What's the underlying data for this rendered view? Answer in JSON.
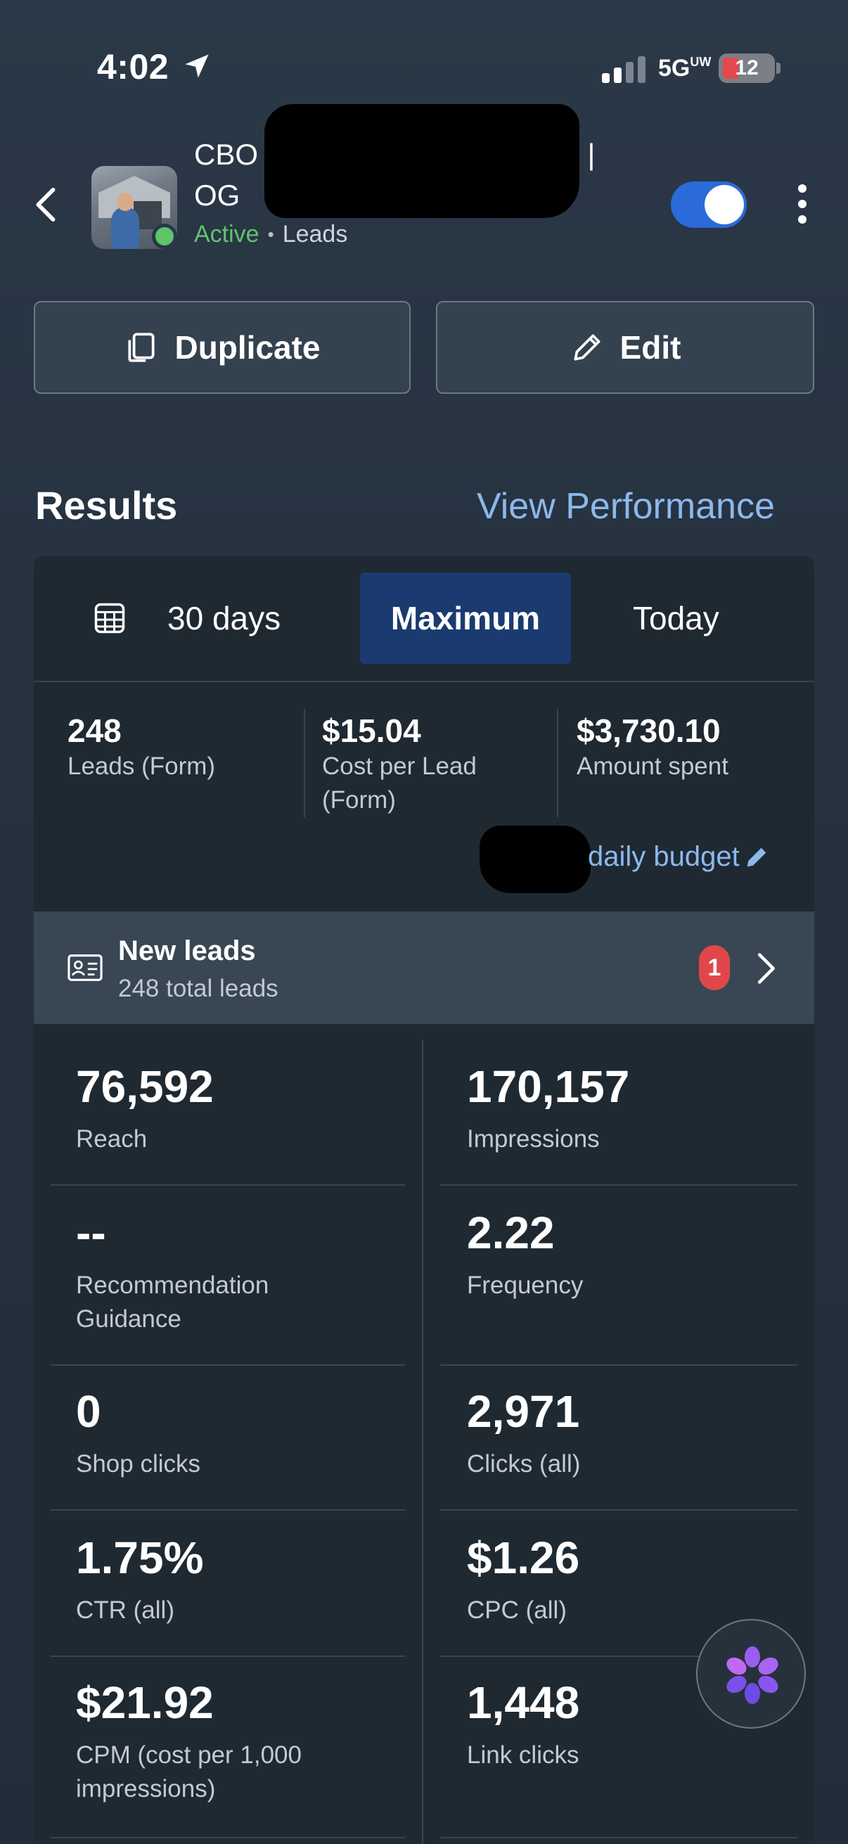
{
  "status_bar": {
    "time": "4:02",
    "network": "5G",
    "network_sub": "UW",
    "battery": "12"
  },
  "header": {
    "title_line1_start": "CBO",
    "title_line1_end": "L |",
    "title_line2": "OG",
    "status": "Active",
    "separator": "•",
    "objective": "Leads",
    "toggle_on": true
  },
  "actions": {
    "duplicate_label": "Duplicate",
    "edit_label": "Edit"
  },
  "results": {
    "heading": "Results",
    "view_performance": "View Performance"
  },
  "tabs": {
    "range": "30 days",
    "maximum": "Maximum",
    "today": "Today",
    "selected": "Maximum"
  },
  "summary": [
    {
      "value": "248",
      "label": "Leads (Form)"
    },
    {
      "value": "$15.04",
      "label": "Cost per Lead (Form)"
    },
    {
      "value": "$3,730.10",
      "label": "Amount spent"
    }
  ],
  "budget_label": "daily budget",
  "new_leads": {
    "title": "New leads",
    "subtitle": "248 total leads",
    "badge": "1"
  },
  "metrics": [
    {
      "value": "76,592",
      "label": "Reach"
    },
    {
      "value": "170,157",
      "label": "Impressions"
    },
    {
      "value": "--",
      "label": "Recommendation Guidance"
    },
    {
      "value": "2.22",
      "label": "Frequency"
    },
    {
      "value": "0",
      "label": "Shop clicks"
    },
    {
      "value": "2,971",
      "label": "Clicks (all)"
    },
    {
      "value": "1.75%",
      "label": "CTR (all)"
    },
    {
      "value": "$1.26",
      "label": "CPC (all)"
    },
    {
      "value": "$21.92",
      "label": "CPM (cost per 1,000 impressions)"
    },
    {
      "value": "1,448",
      "label": "Link clicks"
    }
  ],
  "colors": {
    "accent_blue": "#8cb8ec",
    "active_green": "#63c46f",
    "toggle_blue": "#2a6ad9",
    "badge_red": "#e0474b",
    "selected_tab": "#1b3a6f"
  }
}
